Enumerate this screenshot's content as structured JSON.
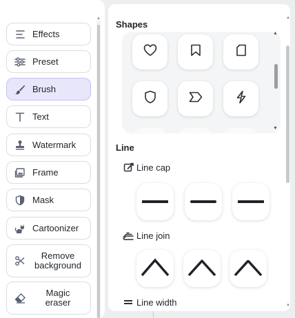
{
  "sidebar": {
    "items": [
      {
        "label": "Effects",
        "icon": "effects-lines-icon"
      },
      {
        "label": "Preset",
        "icon": "sliders-icon"
      },
      {
        "label": "Brush",
        "icon": "brush-icon",
        "active": true
      },
      {
        "label": "Text",
        "icon": "text-icon"
      },
      {
        "label": "Watermark",
        "icon": "stamp-icon"
      },
      {
        "label": "Frame",
        "icon": "frame-image-icon"
      },
      {
        "label": "Mask",
        "icon": "shield-half-icon"
      },
      {
        "label": "Cartoonizer",
        "icon": "cat-icon"
      },
      {
        "label": "Remove background",
        "icon": "scissors-icon"
      },
      {
        "label": "Magic eraser",
        "icon": "eraser-icon"
      }
    ]
  },
  "panel": {
    "shapes_title": "Shapes",
    "shapes": [
      {
        "icon": "heart-icon"
      },
      {
        "icon": "bookmark-icon"
      },
      {
        "icon": "tag-icon"
      },
      {
        "icon": "shield-icon"
      },
      {
        "icon": "arrow-tag-icon"
      },
      {
        "icon": "lightning-icon"
      }
    ],
    "line_title": "Line",
    "line_cap": {
      "label": "Line cap",
      "icon": "line-cap-icon",
      "options": [
        "butt-cap",
        "round-cap",
        "square-cap"
      ]
    },
    "line_join": {
      "label": "Line join",
      "icon": "line-join-icon",
      "options": [
        "miter-join",
        "round-join",
        "bevel-join"
      ]
    },
    "line_width": {
      "label": "Line width",
      "icon": "line-width-icon"
    }
  },
  "colors": {
    "active_bg": "#e8e6fb",
    "accent_brush": "#4a5068"
  }
}
